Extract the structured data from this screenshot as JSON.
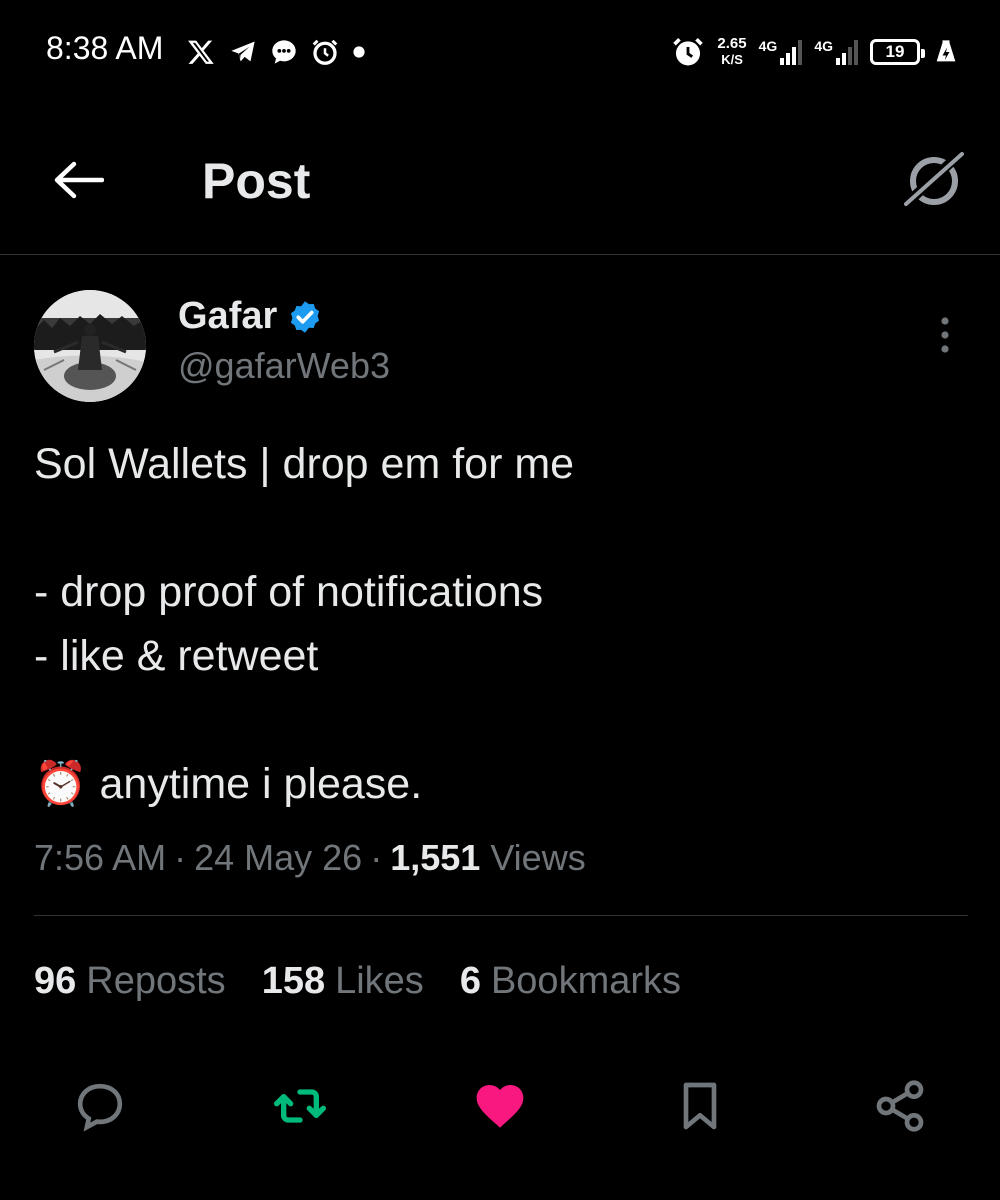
{
  "status_bar": {
    "time": "8:38 AM",
    "speed_value": "2.65",
    "speed_unit": "K/S",
    "network1": "4G",
    "network2": "4G",
    "battery": "19",
    "icons": [
      "x-logo-icon",
      "telegram-icon",
      "message-bubble-icon",
      "alarm-icon",
      "dot-icon"
    ]
  },
  "header": {
    "title": "Post"
  },
  "author": {
    "name": "Gafar",
    "handle": "@gafarWeb3",
    "verified_color": "#1d9bf0"
  },
  "tweet": {
    "text": "Sol Wallets | drop em for me\n\n- drop proof of notifications\n- like & retweet\n\n⏰ anytime i please.",
    "time": "7:56 AM",
    "date": "24 May 26",
    "views_count": "1,551",
    "views_label": "Views",
    "separator": "·"
  },
  "stats": {
    "reposts_count": "96",
    "reposts_label": "Reposts",
    "likes_count": "158",
    "likes_label": "Likes",
    "bookmarks_count": "6",
    "bookmarks_label": "Bookmarks"
  },
  "actions": {
    "retweet_color": "#00ba7c",
    "like_color": "#f91880",
    "icon_color": "#71767b"
  }
}
